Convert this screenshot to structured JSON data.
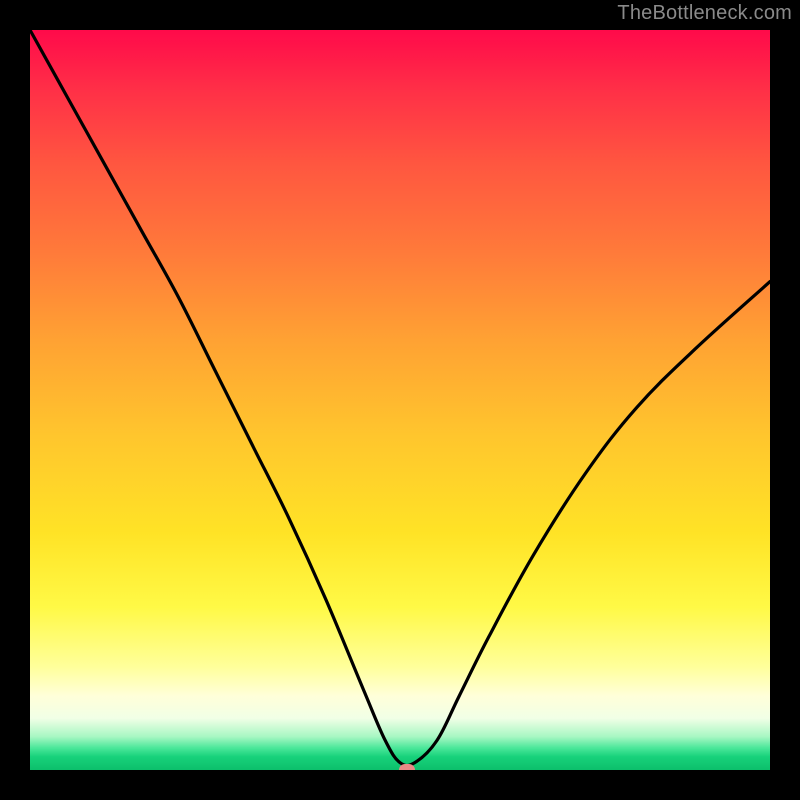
{
  "watermark": "TheBottleneck.com",
  "chart_data": {
    "type": "line",
    "title": "",
    "xlabel": "",
    "ylabel": "",
    "xlim": [
      0,
      100
    ],
    "ylim": [
      0,
      100
    ],
    "grid": false,
    "legend": false,
    "background_gradient": {
      "direction": "vertical",
      "stops": [
        {
          "pos": 0.0,
          "color": "#ff0a4a"
        },
        {
          "pos": 0.18,
          "color": "#ff5640"
        },
        {
          "pos": 0.42,
          "color": "#ffa233"
        },
        {
          "pos": 0.68,
          "color": "#ffe326"
        },
        {
          "pos": 0.86,
          "color": "#ffff9a"
        },
        {
          "pos": 0.95,
          "color": "#a7f7c3"
        },
        {
          "pos": 1.0,
          "color": "#0cbf6b"
        }
      ]
    },
    "series": [
      {
        "name": "curve",
        "x": [
          0,
          5,
          10,
          15,
          20,
          25,
          30,
          35,
          40,
          45,
          48,
          50,
          52,
          55,
          58,
          62,
          68,
          75,
          82,
          90,
          100
        ],
        "y": [
          100,
          91,
          82,
          73,
          64,
          54,
          44,
          34,
          23,
          11,
          4,
          1,
          1,
          4,
          10,
          18,
          29,
          40,
          49,
          57,
          66
        ]
      }
    ],
    "marker": {
      "x": 51,
      "y": 0,
      "color": "#e88a86"
    }
  }
}
